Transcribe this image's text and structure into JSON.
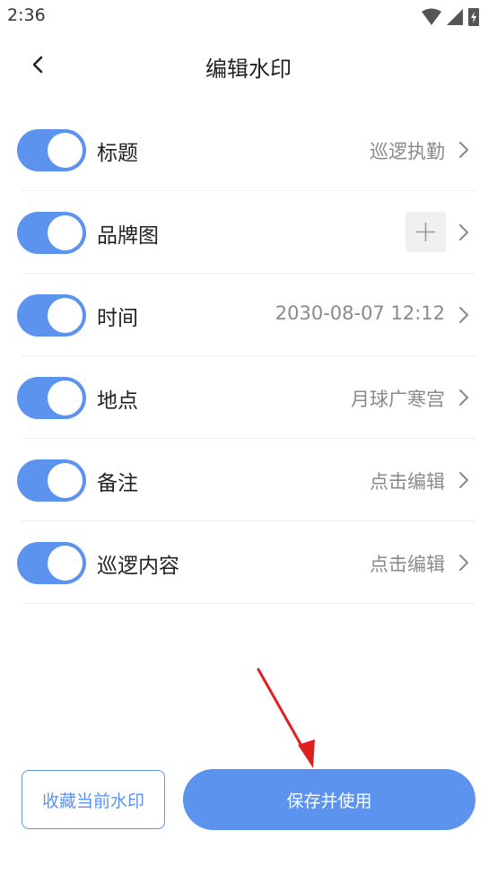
{
  "status_bar": {
    "time": "2:36"
  },
  "header": {
    "title": "编辑水印"
  },
  "rows": [
    {
      "label": "标题",
      "value": "巡逻执勤",
      "enabled": true
    },
    {
      "label": "品牌图",
      "value": "",
      "enabled": true
    },
    {
      "label": "时间",
      "value": "2030-08-07 12:12",
      "enabled": true
    },
    {
      "label": "地点",
      "value": "月球广寒宫",
      "enabled": true
    },
    {
      "label": "备注",
      "value": "点击编辑",
      "enabled": true
    },
    {
      "label": "巡逻内容",
      "value": "点击编辑",
      "enabled": true
    }
  ],
  "actions": {
    "favorite_label": "收藏当前水印",
    "save_label": "保存并使用"
  },
  "colors": {
    "accent": "#5b93ef",
    "annotation_arrow": "#e02020"
  },
  "icons": {
    "back": "chevron-left-icon",
    "chevron": "chevron-right-icon",
    "brand_add": "plus-icon",
    "wifi": "wifi-icon",
    "signal": "cell-signal-icon",
    "battery": "battery-charging-icon"
  }
}
